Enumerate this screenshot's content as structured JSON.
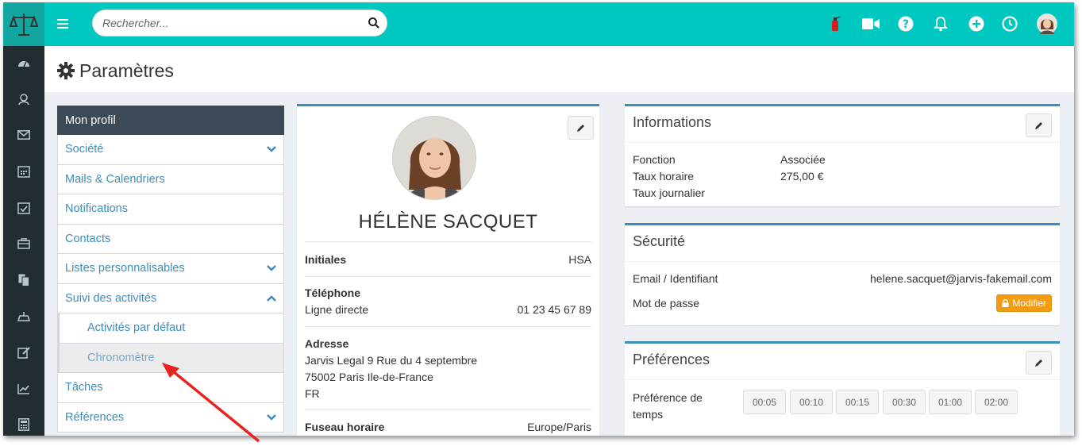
{
  "colors": {
    "topbar": "#00c7c0",
    "sidebar": "#222d32",
    "accent": "#3c8dbc",
    "warning": "#f39c12",
    "arrow": "#e8221f"
  },
  "search": {
    "placeholder": "Rechercher..."
  },
  "topbar_icons": [
    "fire-extinguisher-icon",
    "video-camera-icon",
    "help-icon",
    "bell-icon",
    "plus-circle-icon",
    "clock-icon",
    "user-avatar"
  ],
  "sidebar_icons": [
    "dashboard-icon",
    "contacts-icon",
    "mail-icon",
    "calendar-icon",
    "calendar-check-icon",
    "briefcase-icon",
    "documents-icon",
    "scale-icon",
    "edit-icon",
    "chart-icon",
    "calculator-icon"
  ],
  "page": {
    "title": "Paramètres"
  },
  "settings_menu": {
    "header": "Mon profil",
    "items": [
      {
        "label": "Société",
        "chevron": "down"
      },
      {
        "label": "Mails & Calendriers"
      },
      {
        "label": "Notifications"
      },
      {
        "label": "Contacts"
      },
      {
        "label": "Listes personnalisables",
        "chevron": "down"
      },
      {
        "label": "Suivi des activités",
        "chevron": "up"
      },
      {
        "label": "Activités par défaut",
        "sub": true
      },
      {
        "label": "Chronomètre",
        "sub": true,
        "active": true
      },
      {
        "label": "Tâches"
      },
      {
        "label": "Références",
        "chevron": "down"
      }
    ]
  },
  "profile": {
    "name": "HÉLÈNE SACQUET",
    "initials_label": "Initiales",
    "initials": "HSA",
    "phone_label": "Téléphone",
    "direct_line_label": "Ligne directe",
    "direct_line": "01 23 45 67 89",
    "address_label": "Adresse",
    "address_line1": "Jarvis Legal 9 Rue du 4 septembre",
    "address_line2": "75002 Paris Ile-de-France",
    "address_line3": "FR",
    "timezone_label": "Fuseau horaire",
    "timezone": "Europe/Paris"
  },
  "informations": {
    "title": "Informations",
    "function_label": "Fonction",
    "function": "Associée",
    "hourly_label": "Taux horaire",
    "hourly": "275,00 €",
    "daily_label": "Taux journalier"
  },
  "securite": {
    "title": "Sécurité",
    "email_label": "Email / Identifiant",
    "email": "helene.sacquet@jarvis-fakemail.com",
    "password_label": "Mot de passe",
    "modify_label": "Modifier"
  },
  "preferences": {
    "title": "Préférences",
    "time_label_1": "Préférence de",
    "time_label_2": "temps",
    "times": [
      "00:05",
      "00:10",
      "00:15",
      "00:30",
      "01:00",
      "02:00"
    ]
  }
}
